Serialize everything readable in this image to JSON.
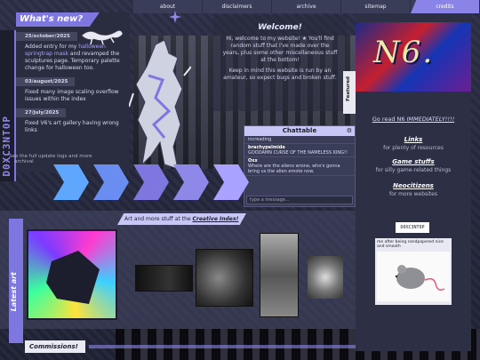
{
  "nav": {
    "items": [
      "about",
      "disclaimers",
      "archive",
      "sitemap",
      "credits"
    ]
  },
  "side_tab": {
    "label": "D0XC3NT0P"
  },
  "whats_new": {
    "title": "What's new?",
    "entries": [
      {
        "date": "25/october/2025",
        "text_a": "Added entry for my ",
        "highlight": "halloween springtrap mask",
        "text_b": " and revamped the sculptures page. Temporary palette change for halloween too."
      },
      {
        "date": "03/august/2025",
        "text": "Fixed many image scaling overflow issues within the index"
      },
      {
        "date": "27/july/2025",
        "text": "Fixed V6's art gallery having wrong links"
      }
    ],
    "footer_text": "See the full update logs and more",
    "footer_link": "archival"
  },
  "welcome": {
    "title": "Welcome!",
    "body": "Hi, welcome to my website! ★ You'll find random stuff that I've made over the years, plus some other miscellaneous stuff at the bottom!",
    "note": "Keep in mind this website is run by an amateur, so expect bugs and broken stuff."
  },
  "featured_label": "Featured",
  "n6": {
    "banner_text": "N6.",
    "read_prefix": "Go read N6 ",
    "read_emph": "IMMEDIATELY!!!!"
  },
  "right_links": [
    {
      "label": "Links",
      "desc": "for plenty of resources"
    },
    {
      "label": "Game stuffs",
      "desc": "for silly game-related things"
    },
    {
      "label": "Neocitizens",
      "desc": "for more websites"
    }
  ],
  "badge_text": "D0XC3NT0P",
  "tweet_text": "me after being sandpapered nice and smooth",
  "chatbox": {
    "title": "Chattable",
    "gear_icon": "gear-icon",
    "messages": [
      {
        "name": "",
        "text": "increading"
      },
      {
        "name": "brachypelmide",
        "text": "GOODAMN CURSE OF THE NAMELESS KING!!"
      },
      {
        "name": "Oxx",
        "text": "Where are the aliens wrone, who's gonna bring us the alien emote now."
      }
    ],
    "placeholder": "type a message..."
  },
  "creative": {
    "prefix": "Art and more stuff at the ",
    "link": "Creative Index!"
  },
  "latest_art_label": "Latest art",
  "commissions_label": "Commissions!",
  "colors": {
    "accent": "#7e77df",
    "accent_light": "#c8c6f5",
    "panel": "#2a2c40",
    "background": "#23263a"
  }
}
